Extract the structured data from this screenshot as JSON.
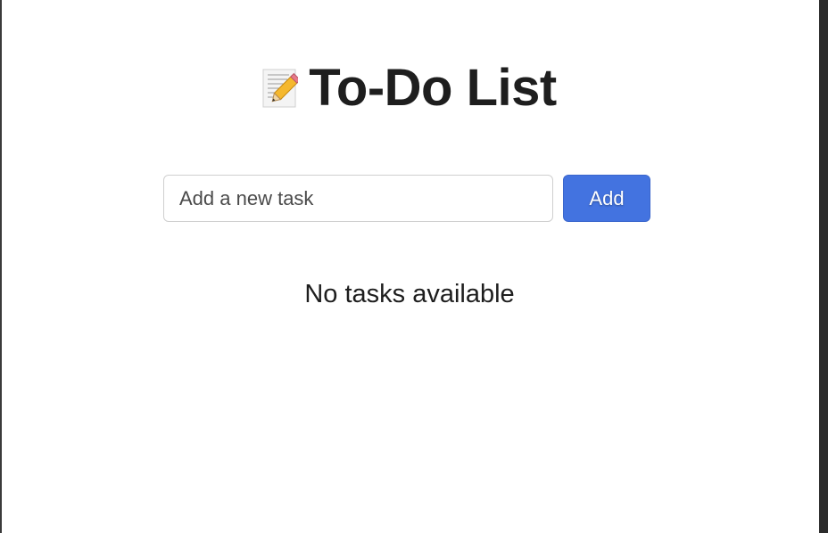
{
  "header": {
    "icon": "memo-pencil-icon",
    "title": "To-Do List"
  },
  "form": {
    "input_placeholder": "Add a new task",
    "input_value": "",
    "add_label": "Add",
    "accent_color": "#4373e0"
  },
  "tasks": {
    "items": [],
    "empty_message": "No tasks available"
  }
}
